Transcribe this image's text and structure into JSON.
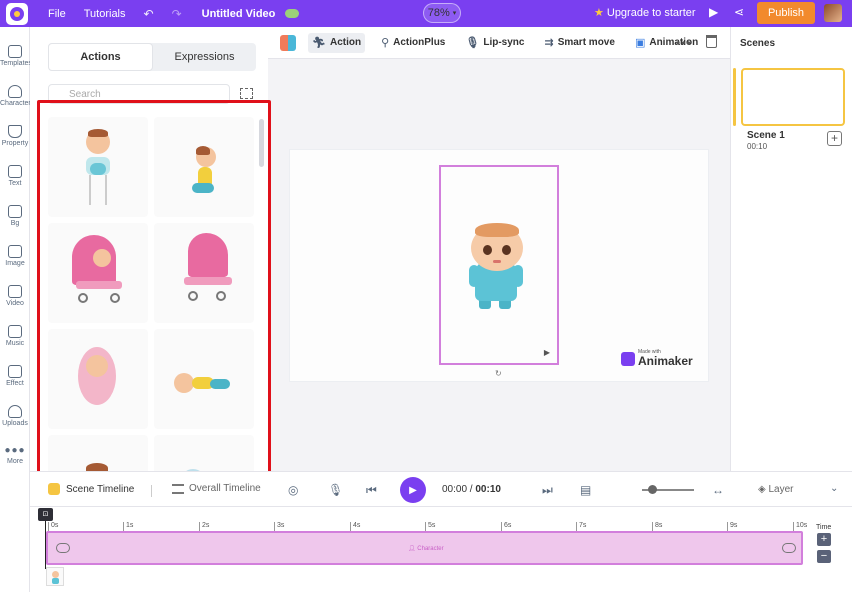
{
  "topbar": {
    "file": "File",
    "tutorials": "Tutorials",
    "title": "Untitled Video",
    "zoom": "78%",
    "upgrade": "Upgrade to starter",
    "publish": "Publish"
  },
  "rail": [
    {
      "label": "Templates"
    },
    {
      "label": "Character"
    },
    {
      "label": "Property"
    },
    {
      "label": "Text"
    },
    {
      "label": "Bg"
    },
    {
      "label": "Image"
    },
    {
      "label": "Video"
    },
    {
      "label": "Music"
    },
    {
      "label": "Effect"
    },
    {
      "label": "Uploads"
    },
    {
      "label": "More"
    }
  ],
  "panel": {
    "tabs": [
      "Actions",
      "Expressions"
    ],
    "search_placeholder": "Search"
  },
  "toolbar": {
    "action": "Action",
    "actionplus": "ActionPlus",
    "lipsync": "Lip-sync",
    "smartmove": "Smart move",
    "animation": "Animation"
  },
  "watermark": {
    "small": "Made with",
    "big": "Animaker"
  },
  "scenes": {
    "title": "Scenes",
    "items": [
      {
        "name": "Scene 1",
        "duration": "00:10"
      }
    ]
  },
  "timeline": {
    "scene_tab": "Scene Timeline",
    "overall_tab": "Overall Timeline",
    "current": "00:00",
    "total": "00:10",
    "layer": "Layer",
    "ticks": [
      "0s",
      "1s",
      "2s",
      "3s",
      "4s",
      "5s",
      "6s",
      "7s",
      "8s",
      "9s",
      "10s"
    ],
    "track_label": "Character",
    "time_label": "Time"
  }
}
